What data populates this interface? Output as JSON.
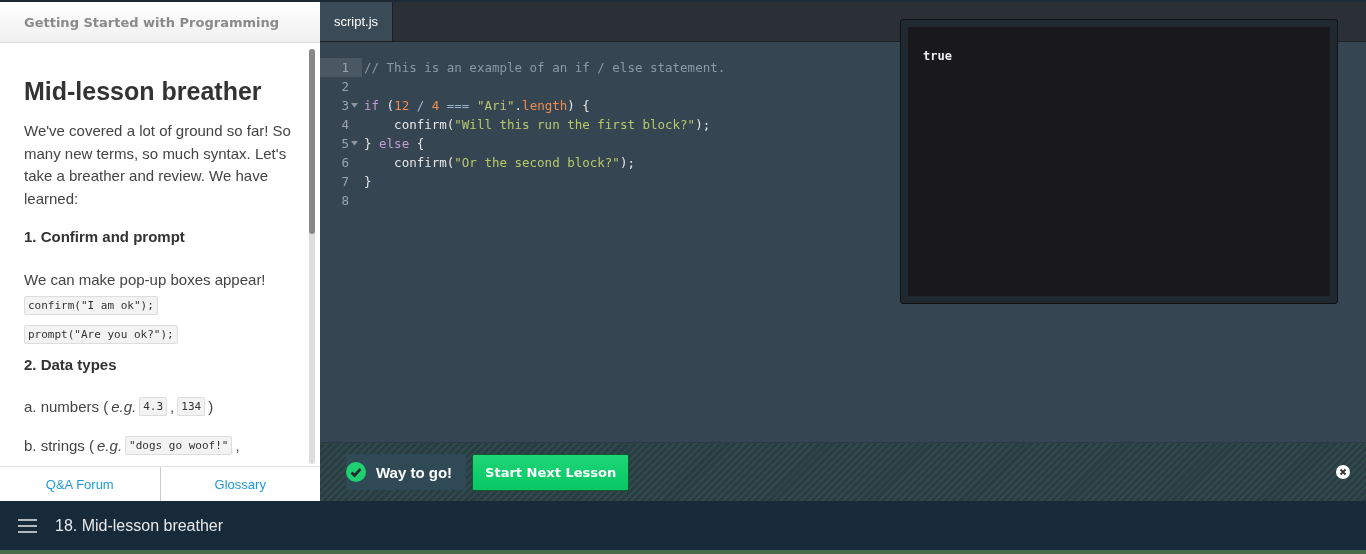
{
  "course_title": "Getting Started with Programming",
  "lesson": {
    "blocks": [
      {
        "kind": "title",
        "text": "Mid-lesson breather"
      },
      {
        "kind": "para",
        "text": "We've covered a lot of ground so far! So many new terms, so much syntax. Let's take a breather and review. We have learned:"
      },
      {
        "kind": "subheading",
        "text": "1. Confirm and prompt"
      },
      {
        "kind": "para",
        "text": "We can make pop-up boxes appear!"
      },
      {
        "kind": "code",
        "text": "confirm(\"I am ok\");"
      },
      {
        "kind": "code",
        "text": "prompt(\"Are you ok?\");"
      },
      {
        "kind": "subheading",
        "text": "2. Data types"
      },
      {
        "kind": "mixed",
        "parts": [
          {
            "kind": "text",
            "text": "a. numbers ("
          },
          {
            "kind": "text",
            "text": "*e.g.*"
          },
          {
            "kind": "code",
            "text": "4.3"
          },
          {
            "kind": "text",
            "text": ","
          },
          {
            "kind": "code",
            "text": "134"
          },
          {
            "kind": "text",
            "text": ")"
          }
        ]
      },
      {
        "kind": "mixed",
        "parts": [
          {
            "kind": "text",
            "text": "b. strings ("
          },
          {
            "kind": "text",
            "text": "*e.g.*"
          },
          {
            "kind": "code",
            "text": "\"dogs go woof!\""
          },
          {
            "kind": "text",
            "text": ","
          }
        ]
      }
    ]
  },
  "footer_links": [
    "Q&A Forum",
    "Glossary"
  ],
  "tabs": [
    {
      "label": "script.js",
      "selected": true
    }
  ],
  "code_lines": [
    {
      "number": "1",
      "active": true,
      "foldable": false,
      "tokens": [
        {
          "kind": "comment",
          "text": "// This is an example of an if / else statement."
        }
      ]
    },
    {
      "number": "2",
      "active": false,
      "foldable": false
    },
    {
      "number": "3",
      "active": false,
      "foldable": true,
      "tokens": [
        {
          "kind": "keyword",
          "text": "if"
        },
        {
          "kind": "plain",
          "text": " ("
        },
        {
          "kind": "number",
          "text": "12"
        },
        {
          "kind": "operator",
          "text": " / "
        },
        {
          "kind": "number",
          "text": "4"
        },
        {
          "kind": "operator",
          "text": " === "
        },
        {
          "kind": "string",
          "text": "\"Ari\""
        },
        {
          "kind": "plain",
          "text": "."
        },
        {
          "kind": "property",
          "text": "length"
        },
        {
          "kind": "plain",
          "text": ") {"
        }
      ]
    },
    {
      "number": "4",
      "active": false,
      "foldable": false,
      "tokens": [
        {
          "kind": "plain",
          "text": "    confirm("
        },
        {
          "kind": "string",
          "text": "\"Will this run the first block?\""
        },
        {
          "kind": "plain",
          "text": ");"
        }
      ]
    },
    {
      "number": "5",
      "active": false,
      "foldable": true,
      "tokens": [
        {
          "kind": "plain",
          "text": "} "
        },
        {
          "kind": "keyword",
          "text": "else"
        },
        {
          "kind": "plain",
          "text": " {"
        }
      ]
    },
    {
      "number": "6",
      "active": false,
      "foldable": false,
      "tokens": [
        {
          "kind": "plain",
          "text": "    confirm("
        },
        {
          "kind": "string",
          "text": "\"Or the second block?\""
        },
        {
          "kind": "plain",
          "text": ");"
        }
      ]
    },
    {
      "number": "7",
      "active": false,
      "foldable": false,
      "tokens": [
        {
          "kind": "plain",
          "text": "}"
        }
      ]
    },
    {
      "number": "8",
      "active": false,
      "foldable": false
    }
  ],
  "output": {
    "text": "true"
  },
  "success_bar": {
    "message": "Way to go!",
    "button": "Start Next Lesson"
  },
  "bottom_bar": {
    "title": "18. Mid-lesson breather"
  }
}
